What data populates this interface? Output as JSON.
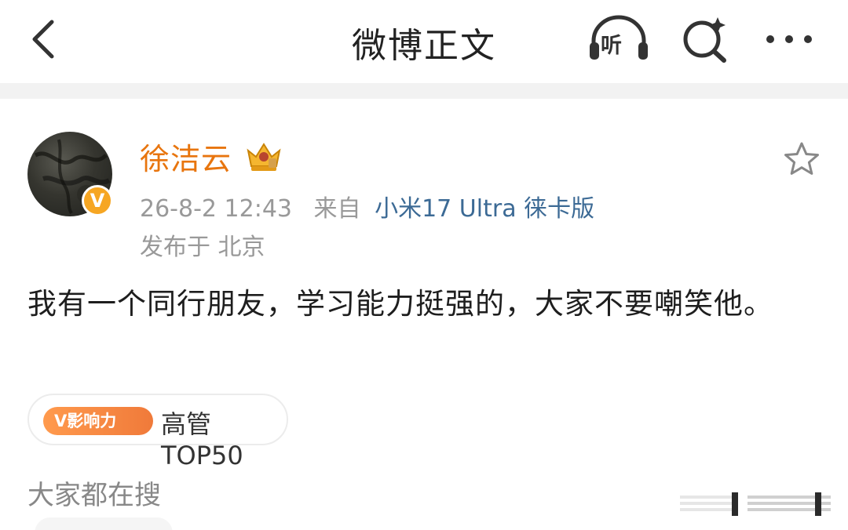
{
  "header": {
    "title": "微博正文",
    "listen_label": "听"
  },
  "post": {
    "author": "徐洁云",
    "verified_badge": "V",
    "timestamp": "26-8-2 12:43",
    "source_prefix": "来自",
    "source_device": "小米17 Ultra 徕卡版",
    "location": "发布于 北京",
    "content": "我有一个同行朋友，学习能力挺强的，大家不要嘲笑他。"
  },
  "influence": {
    "badge_label": "V影响力",
    "rank_label": "高管TOP50"
  },
  "trending": {
    "title": "大家都在搜"
  },
  "colors": {
    "author_orange": "#e8750e",
    "source_blue": "#3c6a95",
    "verified_gold": "#f6a623",
    "influence_orange": "#f07a3a"
  },
  "icons": [
    "back-arrow-icon",
    "listen-icon",
    "search-sparkle-icon",
    "more-icon",
    "crown-icon",
    "star-outline-icon",
    "scroll-indicator-icon"
  ]
}
